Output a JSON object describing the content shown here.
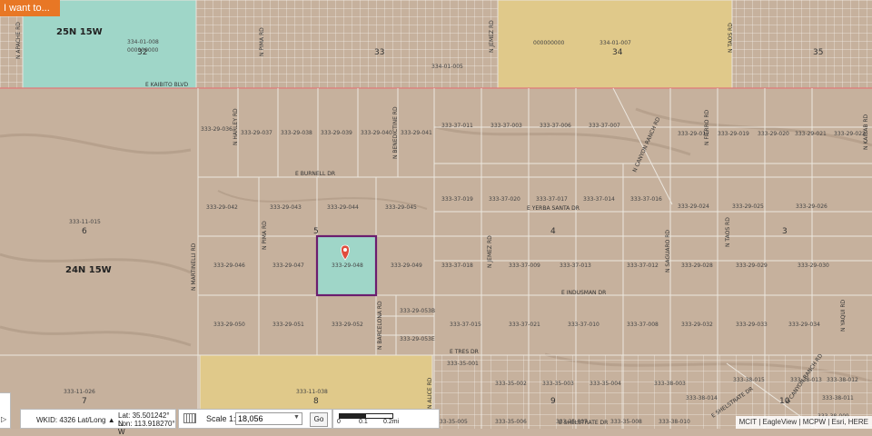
{
  "toolbar": {
    "i_want_to": "I want to..."
  },
  "townships": {
    "north": "25N 15W",
    "south": "24N 15W"
  },
  "sections": [
    {
      "num": "32"
    },
    {
      "num": "33"
    },
    {
      "num": "34"
    },
    {
      "num": "35"
    },
    {
      "num": "5"
    },
    {
      "num": "4"
    },
    {
      "num": "3"
    },
    {
      "num": "6"
    },
    {
      "num": "7"
    },
    {
      "num": "8"
    },
    {
      "num": "9"
    },
    {
      "num": "10"
    }
  ],
  "roads": {
    "kaibito": "E KAIBITO BLVD",
    "burnell": "E BURNELL DR",
    "yerba": "E YERBA SANTA DR",
    "indus": "E INDUSMAN DR",
    "tres": "E TRES DR",
    "shelstrate": "E SHELSTRATE DR",
    "shelstrate2": "E SHELSTRATE DR",
    "apache": "N APACHE RD",
    "pima_top": "N PIMA RD",
    "pima": "N PIMA RD",
    "jemez": "N JEMEZ RD",
    "jemez2": "N JEMEZ RD",
    "taos": "N TAOS RD",
    "taos2": "N TAOS RD",
    "martinelli": "N MARTINELLI RD",
    "harley": "N HARLEY RD",
    "benedictine": "N BENEDICTINE RD",
    "canyon": "N CANYON RANCH RD",
    "fierro": "N FIERRO RD",
    "kaibab": "N KAIBAB RD",
    "saguaro": "N SAGUARO RD",
    "barcelona": "N BARCELONA RD",
    "alice": "N ALICE RD",
    "canyon2": "N CANYON RANCH RD",
    "yaqui": "N YAQUI RD"
  },
  "parcels": [
    "334-01-008",
    "000000000",
    "000000000",
    "334-01-007",
    "334-01-005",
    "333-11-015",
    "333-11-026",
    "333-11-038",
    "333-29-036",
    "333-29-037",
    "333-29-038",
    "333-29-039",
    "333-29-040",
    "333-29-041",
    "333-29-042",
    "333-29-043",
    "333-29-044",
    "333-29-045",
    "333-29-046",
    "333-29-047",
    "333-29-048",
    "333-29-049",
    "333-29-050",
    "333-29-051",
    "333-29-052",
    "333-29-053B",
    "333-29-053E",
    "333-37-011",
    "333-37-003",
    "333-37-006",
    "333-37-007",
    "333-37-019",
    "333-37-020",
    "333-37-017",
    "333-37-014",
    "333-37-016",
    "333-37-018",
    "333-37-009",
    "333-37-013",
    "333-37-012",
    "333-37-015",
    "333-37-021",
    "333-37-010",
    "333-37-008",
    "333-29-017",
    "333-29-019",
    "333-29-020",
    "333-29-021",
    "333-29-022",
    "333-29-024",
    "333-29-025",
    "333-29-026",
    "333-29-028",
    "333-29-029",
    "333-29-030",
    "333-29-032",
    "333-29-033",
    "333-29-034",
    "333-35-001",
    "333-35-002",
    "333-35-003",
    "333-35-004",
    "333-35-005",
    "333-35-006",
    "333-35-007",
    "333-35-008",
    "333-38-015",
    "333-38-003",
    "333-38-014",
    "333-38-013",
    "333-38-012",
    "333-38-011",
    "333-38-010",
    "333-38-009"
  ],
  "selection": {
    "parcel": "333-29-048",
    "color": "#6b1d6e"
  },
  "colors": {
    "teal": "#9fd6c8",
    "yellow": "#e0c98a",
    "desert": "#c8b3a0",
    "road": "#e9e4dc",
    "pin": "#e04c3c"
  },
  "coords": {
    "wkid": "WKID: 4326 Lat/Long ▲",
    "lat": "Lat:     35.501242° N",
    "lon": "Lon:  113.918270° W"
  },
  "scale": {
    "label": "Scale 1:",
    "value": "18,056",
    "go": "Go"
  },
  "scalebar": {
    "t0": "0",
    "t1": "0.1",
    "t2": "0.2mi"
  },
  "attribution": "MCIT | EagleView | MCPW | Esri, HERE",
  "icons": {
    "cursor": "mouse-cursor-icon",
    "scale": "ruler-icon",
    "pin": "map-pin-icon"
  }
}
